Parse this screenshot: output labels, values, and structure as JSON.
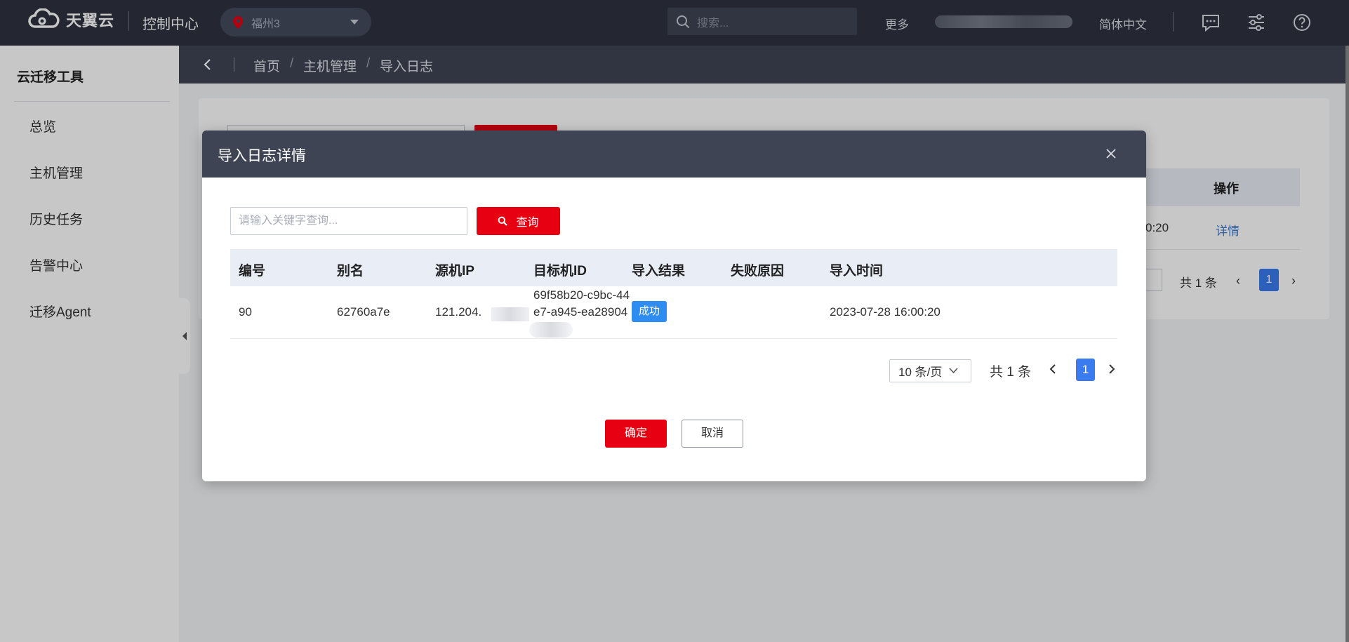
{
  "header": {
    "brand": "天翼云",
    "console": "控制中心",
    "region": "福州3",
    "search_placeholder": "搜索...",
    "more": "更多",
    "language": "简体中文"
  },
  "sidebar": {
    "title": "云迁移工具",
    "items": [
      {
        "label": "总览"
      },
      {
        "label": "主机管理"
      },
      {
        "label": "历史任务"
      },
      {
        "label": "告警中心"
      },
      {
        "label": "迁移Agent"
      }
    ]
  },
  "breadcrumb": {
    "items": [
      "首页",
      "主机管理",
      "导入日志"
    ],
    "separator": "/"
  },
  "background": {
    "op_header": "操作",
    "time_fragment": "0:20",
    "detail_link": "详情",
    "total": "共 1 条",
    "page": "1"
  },
  "modal": {
    "title": "导入日志详情",
    "search_placeholder": "请输入关键字查询...",
    "search_button": "查询",
    "columns": [
      "编号",
      "别名",
      "源机IP",
      "目标机ID",
      "导入结果",
      "失败原因",
      "导入时间"
    ],
    "rows": [
      {
        "id": "90",
        "alias": "62760a7e",
        "source_ip": "121.204.",
        "target_id_line1": "69f58b20-c9bc-44",
        "target_id_line2": "e7-a945-ea28904",
        "result": "成功",
        "reason": "",
        "time": "2023-07-28 16:00:20"
      }
    ],
    "page_size": "10 条/页",
    "total": "共 1 条",
    "current_page": "1",
    "ok_button": "确定",
    "cancel_button": "取消"
  },
  "colors": {
    "header_bg": "#2f3340",
    "accent_red": "#e60012",
    "page_blue": "#3a7bf0",
    "badge_blue": "#2f8cf0"
  }
}
